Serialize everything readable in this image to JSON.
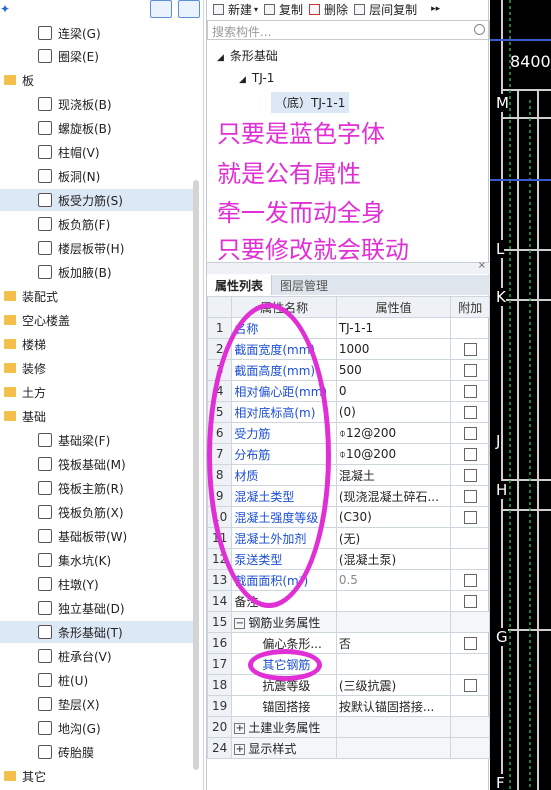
{
  "left_panel": {
    "items": [
      {
        "label": "连梁(G)",
        "icon": "coupling-beam-icon",
        "type": "item"
      },
      {
        "label": "圈梁(E)",
        "icon": "ring-beam-icon",
        "type": "item"
      },
      {
        "label": "板",
        "icon": "folder-icon",
        "type": "category"
      },
      {
        "label": "现浇板(B)",
        "icon": "cast-slab-icon",
        "type": "item"
      },
      {
        "label": "螺旋板(B)",
        "icon": "spiral-slab-icon",
        "type": "item"
      },
      {
        "label": "柱帽(V)",
        "icon": "column-cap-icon",
        "type": "item"
      },
      {
        "label": "板洞(N)",
        "icon": "slab-hole-icon",
        "type": "item"
      },
      {
        "label": "板受力筋(S)",
        "icon": "slab-rebar-icon",
        "type": "item",
        "selected": true
      },
      {
        "label": "板负筋(F)",
        "icon": "slab-neg-rebar-icon",
        "type": "item"
      },
      {
        "label": "楼层板带(H)",
        "icon": "floor-strip-icon",
        "type": "item"
      },
      {
        "label": "板加腋(B)",
        "icon": "slab-haunch-icon",
        "type": "item"
      },
      {
        "label": "装配式",
        "icon": "folder-icon",
        "type": "category"
      },
      {
        "label": "空心楼盖",
        "icon": "folder-icon",
        "type": "category"
      },
      {
        "label": "楼梯",
        "icon": "folder-icon",
        "type": "category"
      },
      {
        "label": "装修",
        "icon": "folder-icon",
        "type": "category"
      },
      {
        "label": "土方",
        "icon": "folder-icon",
        "type": "category"
      },
      {
        "label": "基础",
        "icon": "folder-icon",
        "type": "category"
      },
      {
        "label": "基础梁(F)",
        "icon": "foundation-beam-icon",
        "type": "item"
      },
      {
        "label": "筏板基础(M)",
        "icon": "raft-foundation-icon",
        "type": "item"
      },
      {
        "label": "筏板主筋(R)",
        "icon": "raft-main-rebar-icon",
        "type": "item"
      },
      {
        "label": "筏板负筋(X)",
        "icon": "raft-neg-rebar-icon",
        "type": "item"
      },
      {
        "label": "基础板带(W)",
        "icon": "foundation-strip-icon",
        "type": "item"
      },
      {
        "label": "集水坑(K)",
        "icon": "sump-icon",
        "type": "item"
      },
      {
        "label": "柱墩(Y)",
        "icon": "column-pier-icon",
        "type": "item"
      },
      {
        "label": "独立基础(D)",
        "icon": "isolated-foundation-icon",
        "type": "item"
      },
      {
        "label": "条形基础(T)",
        "icon": "strip-foundation-icon",
        "type": "item",
        "selected": true
      },
      {
        "label": "桩承台(V)",
        "icon": "pile-cap-icon",
        "type": "item"
      },
      {
        "label": "桩(U)",
        "icon": "pile-icon",
        "type": "item"
      },
      {
        "label": "垫层(X)",
        "icon": "cushion-icon",
        "type": "item"
      },
      {
        "label": "地沟(G)",
        "icon": "trench-icon",
        "type": "item"
      },
      {
        "label": "砖胎膜",
        "icon": "brick-mold-icon",
        "type": "item"
      },
      {
        "label": "其它",
        "icon": "folder-icon",
        "type": "category"
      }
    ]
  },
  "toolbar": {
    "new_label": "新建",
    "copy_label": "复制",
    "delete_label": "删除",
    "floor_copy_label": "层间复制",
    "more": "▸▸"
  },
  "search": {
    "placeholder": "搜索构件..."
  },
  "component_tree": {
    "root": "条形基础",
    "child": "TJ-1",
    "leaf": "（底）TJ-1-1"
  },
  "annotations": {
    "line1": "只要是蓝色字体",
    "line2": "就是公有属性",
    "line3": "牵一发而动全身",
    "line4": "只要修改就会联动"
  },
  "props": {
    "tab_list": "属性列表",
    "tab_layers": "图层管理",
    "col_name": "属性名称",
    "col_value": "属性值",
    "col_add": "附加",
    "rows": [
      {
        "num": "1",
        "name": "名称",
        "value": "TJ-1-1",
        "blue": true,
        "cb": false
      },
      {
        "num": "2",
        "name": "截面宽度(mm)",
        "value": "1000",
        "blue": true,
        "cb": true
      },
      {
        "num": "3",
        "name": "截面高度(mm)",
        "value": "500",
        "blue": true,
        "cb": true
      },
      {
        "num": "4",
        "name": "相对偏心距(mm)",
        "value": "0",
        "blue": true,
        "cb": true
      },
      {
        "num": "5",
        "name": "相对底标高(m)",
        "value": "(0)",
        "blue": true,
        "cb": true
      },
      {
        "num": "6",
        "name": "受力筋",
        "value": "⌽12@200",
        "blue": true,
        "cb": true
      },
      {
        "num": "7",
        "name": "分布筋",
        "value": "⌽10@200",
        "blue": true,
        "cb": true
      },
      {
        "num": "8",
        "name": "材质",
        "value": "混凝土",
        "blue": true,
        "cb": true
      },
      {
        "num": "9",
        "name": "混凝土类型",
        "value": "(现浇混凝土碎石...",
        "blue": true,
        "cb": true
      },
      {
        "num": "10",
        "name": "混凝土强度等级",
        "value": "(C30)",
        "blue": true,
        "cb": true
      },
      {
        "num": "11",
        "name": "混凝土外加剂",
        "value": "(无)",
        "blue": true,
        "cb": false
      },
      {
        "num": "12",
        "name": "泵送类型",
        "value": "(混凝土泵)",
        "blue": true,
        "cb": false
      },
      {
        "num": "13",
        "name": "截面面积(m²)",
        "value": "0.5",
        "blue": true,
        "cb": true,
        "grayrow": true
      },
      {
        "num": "14",
        "name": "备注",
        "value": "",
        "blue": false,
        "cb": true
      },
      {
        "num": "15",
        "name": "钢筋业务属性",
        "value": "",
        "blue": false,
        "cb": false,
        "group": "−"
      },
      {
        "num": "16",
        "name": "偏心条形...",
        "value": "否",
        "blue": false,
        "cb": true,
        "indent": true
      },
      {
        "num": "17",
        "name": "其它钢筋",
        "value": "",
        "blue": true,
        "cb": false,
        "indent": true
      },
      {
        "num": "18",
        "name": "抗震等级",
        "value": "(三级抗震)",
        "blue": false,
        "cb": true,
        "indent": true
      },
      {
        "num": "19",
        "name": "锚固搭接",
        "value": "按默认锚固搭接...",
        "blue": false,
        "cb": false,
        "indent": true
      },
      {
        "num": "20",
        "name": "土建业务属性",
        "value": "",
        "blue": false,
        "cb": false,
        "group": "+"
      },
      {
        "num": "24",
        "name": "显示样式",
        "value": "",
        "blue": false,
        "cb": false,
        "group": "+"
      }
    ]
  },
  "cad": {
    "dimension": "8400",
    "axis_labels": [
      "M",
      "L",
      "K",
      "J",
      "H",
      "G",
      "F"
    ]
  },
  "colors": {
    "annotation": "#e12fd6",
    "blue_text": "#1d4fd6",
    "selected": "#dde8f6"
  }
}
